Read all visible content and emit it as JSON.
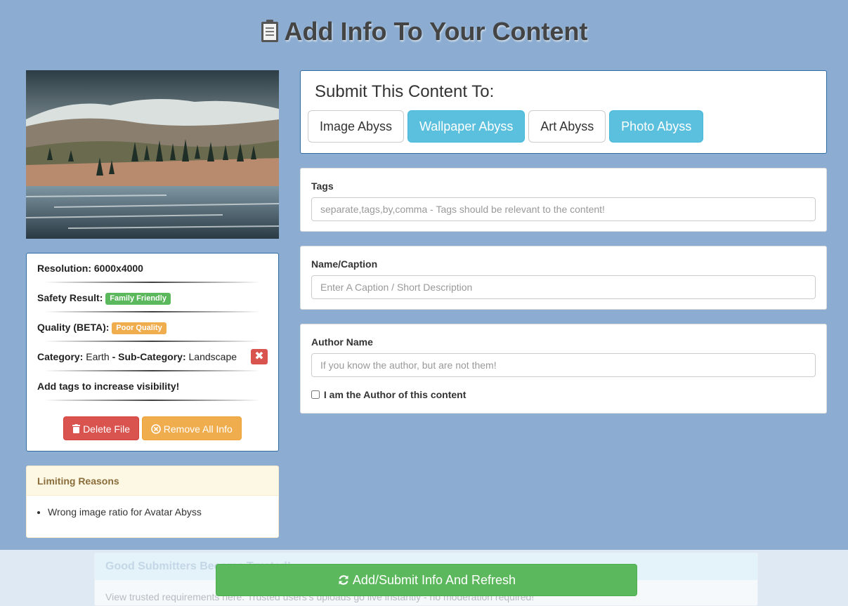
{
  "page": {
    "title": "Add Info To Your Content"
  },
  "info": {
    "resolution_label": "Resolution:",
    "resolution_value": "6000x4000",
    "safety_label": "Safety Result:",
    "safety_badge": "Family Friendly",
    "quality_label": "Quality (BETA):",
    "quality_badge": "Poor Quality",
    "category_label": "Category:",
    "category_value": "Earth",
    "category_sep": "-",
    "subcategory_label": "Sub-Category:",
    "subcategory_value": "Landscape",
    "tags_hint": "Add tags to increase visibility!",
    "delete_label": "Delete File",
    "remove_all_label": "Remove All Info"
  },
  "limiting": {
    "heading": "Limiting Reasons",
    "items": [
      "Wrong image ratio for Avatar Abyss"
    ]
  },
  "submit_to": {
    "heading": "Submit This Content To:",
    "options": [
      {
        "label": "Image Abyss",
        "selected": false
      },
      {
        "label": "Wallpaper Abyss",
        "selected": true
      },
      {
        "label": "Art Abyss",
        "selected": false
      },
      {
        "label": "Photo Abyss",
        "selected": true
      }
    ]
  },
  "fields": {
    "tags": {
      "label": "Tags",
      "value": "",
      "placeholder": "separate,tags,by,comma - Tags should be relevant to the content!"
    },
    "caption": {
      "label": "Name/Caption",
      "value": "",
      "placeholder": "Enter A Caption / Short Description"
    },
    "author": {
      "label": "Author Name",
      "value": "",
      "placeholder": "If you know the author, but are not them!"
    },
    "author_checkbox_label": "I am the Author of this content",
    "author_checkbox_checked": false
  },
  "trusted": {
    "heading": "Good Submitters Become Trusted!",
    "text_before": "View trusted requirements ",
    "link": "here.",
    "text_after": " Trusted users's uploads go live instantly - no moderation required!"
  },
  "footer": {
    "submit_label": "Add/Submit Info And Refresh"
  },
  "colors": {
    "background": "#8cadd1",
    "success": "#5cb85c",
    "info": "#5bc0de",
    "danger": "#d9534f",
    "warning": "#f0ad4e",
    "primary_border": "#2e6da4"
  }
}
